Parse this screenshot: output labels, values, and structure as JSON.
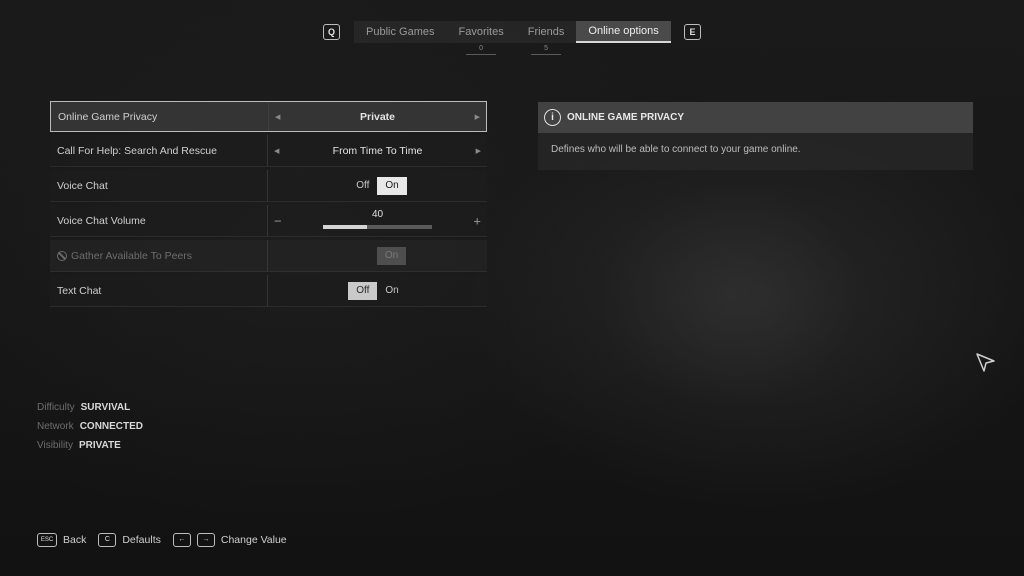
{
  "tabs": {
    "prev_key": "Q",
    "next_key": "E",
    "items": [
      {
        "label": "Public Games",
        "badge": ""
      },
      {
        "label": "Favorites",
        "badge": "0"
      },
      {
        "label": "Friends",
        "badge": "5"
      },
      {
        "label": "Online options",
        "badge": ""
      }
    ],
    "active_index": 3
  },
  "settings": [
    {
      "label": "Online Game Privacy",
      "type": "selector",
      "value": "Private",
      "selected": true
    },
    {
      "label": "Call For Help: Search And Rescue",
      "type": "selector",
      "value": "From Time To Time"
    },
    {
      "label": "Voice Chat",
      "type": "toggle",
      "off_label": "Off",
      "on_label": "On",
      "state": "On"
    },
    {
      "label": "Voice Chat Volume",
      "type": "slider",
      "value": "40",
      "fraction": 0.4,
      "minus": "−",
      "plus": "+"
    },
    {
      "label": "Gather Available To Peers",
      "type": "toggle",
      "on_label": "On",
      "disabled": true
    },
    {
      "label": "Text Chat",
      "type": "toggle",
      "off_label": "Off",
      "on_label": "On",
      "state": "Off"
    }
  ],
  "info": {
    "title": "ONLINE GAME PRIVACY",
    "icon": "info-icon",
    "icon_glyph": "i",
    "description": "Defines who will be able to connect to your game online."
  },
  "status": [
    {
      "key": "Difficulty",
      "value": "SURVIVAL"
    },
    {
      "key": "Network",
      "value": "CONNECTED"
    },
    {
      "key": "Visibility",
      "value": "PRIVATE"
    }
  ],
  "hints": {
    "back_key": "ESC",
    "back_label": "Back",
    "defaults_key": "C",
    "defaults_label": "Defaults",
    "left_key": "←",
    "right_key": "→",
    "change_label": "Change Value"
  },
  "colors": {
    "accent": "#e8e8e8",
    "background": "#141414",
    "panel": "#3a3a3a"
  }
}
